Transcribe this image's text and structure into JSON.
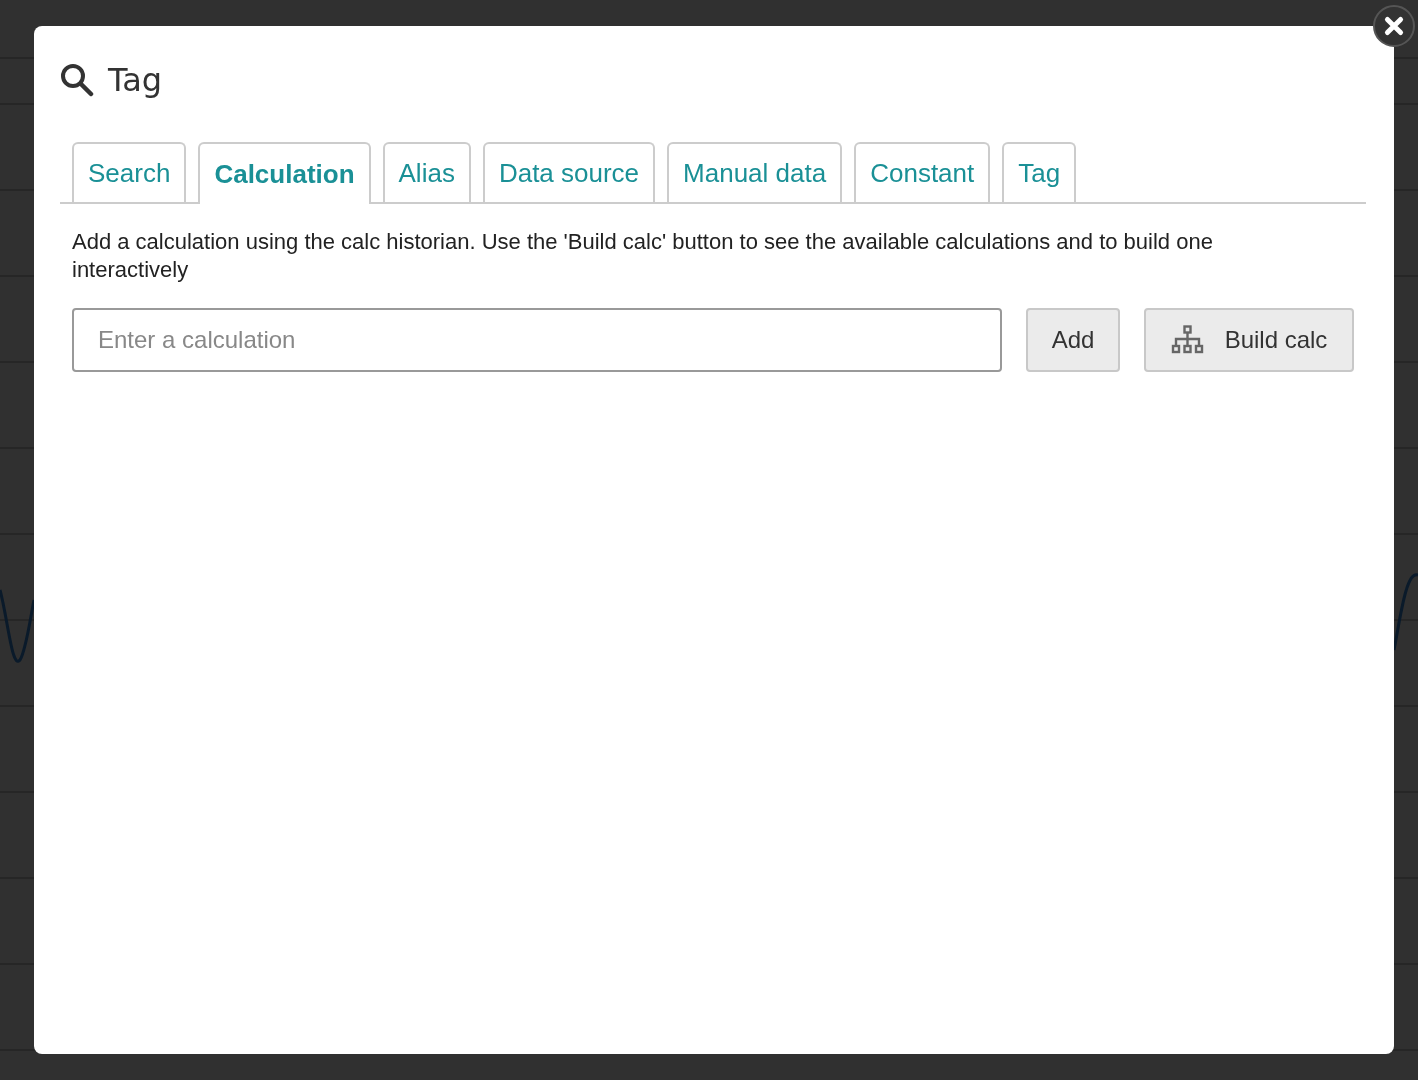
{
  "dialog": {
    "title": "Tag"
  },
  "tabs": [
    {
      "label": "Search",
      "selected": false
    },
    {
      "label": "Calculation",
      "selected": true
    },
    {
      "label": "Alias",
      "selected": false
    },
    {
      "label": "Data source",
      "selected": false
    },
    {
      "label": "Manual data",
      "selected": false
    },
    {
      "label": "Constant",
      "selected": false
    },
    {
      "label": "Tag",
      "selected": false
    }
  ],
  "description": "Add a calculation using the calc historian. Use the 'Build calc' button to see the available calculations and to build one interactively",
  "calculation_field": {
    "placeholder": "Enter a calculation"
  },
  "buttons": [
    {
      "kind": "plain",
      "label": "Add"
    },
    {
      "kind": "tree",
      "label": "Build calc"
    }
  ]
}
